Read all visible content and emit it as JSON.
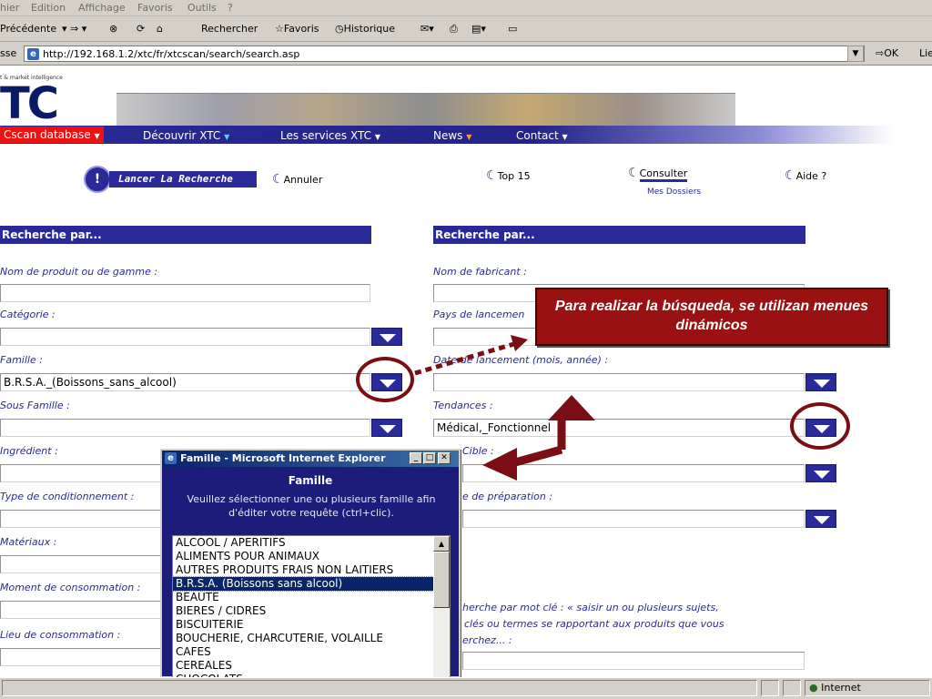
{
  "menubar": {
    "items": [
      "hier",
      "Edition",
      "Affichage",
      "Favoris",
      "Outils",
      "?"
    ]
  },
  "toolbar": {
    "back": "Précédente",
    "search": "Rechercher",
    "favorites": "Favoris",
    "history": "Historique"
  },
  "address": {
    "label": "sse",
    "url": "http://192.168.1.2/xtc/fr/xtcscan/search/search.asp",
    "go": "OK",
    "links": "Lie"
  },
  "site": {
    "tagline": "t & market intelligence",
    "logo": "TC",
    "nav": [
      "Cscan database",
      "Découvrir XTC",
      "Les services XTC",
      "News",
      "Contact"
    ],
    "actions": {
      "search": "Lancer La Recherche",
      "cancel": "Annuler",
      "top": "Top 15",
      "consult": "Consulter",
      "dossiers": "Mes Dossiers",
      "help": "Aide ?"
    }
  },
  "left": {
    "header": "Recherche par...",
    "fields": [
      {
        "label": "Nom de produit ou de gamme :",
        "value": ""
      },
      {
        "label": "Catégorie :",
        "value": ""
      },
      {
        "label": "Famille :",
        "value": "B.R.S.A._(Boissons_sans_alcool)"
      },
      {
        "label": "Sous Famille :",
        "value": ""
      },
      {
        "label": "Ingrédient :",
        "value": ""
      },
      {
        "label": "Type de conditionnement :",
        "value": ""
      },
      {
        "label": "Matériaux :",
        "value": ""
      },
      {
        "label": "Moment de consommation :",
        "value": ""
      },
      {
        "label": "Lieu de consommation :",
        "value": ""
      }
    ]
  },
  "right": {
    "header": "Recherche par...",
    "fields": [
      {
        "label": "Nom de fabricant :",
        "value": ""
      },
      {
        "label": "Pays de lancemen",
        "value": ""
      },
      {
        "label": "Date de lancement (mois, année) :",
        "value": ""
      },
      {
        "label": "Tendances :",
        "value": "Médical,_Fonctionnel"
      },
      {
        "label": "Cible :",
        "value": ""
      },
      {
        "label": "e de préparation :",
        "value": ""
      }
    ],
    "keyword": {
      "line1": "herche par mot clé : « saisir un ou plusieurs sujets,",
      "line2": "clés ou termes se rapportant aux produits que vous",
      "line3": "erchez... :"
    }
  },
  "callout": {
    "text": "Para realizar la búsqueda, se utilizan menues dinámicos"
  },
  "popup": {
    "title": "Famille - Microsoft Internet Explorer",
    "heading": "Famille",
    "instruction": "Veuillez sélectionner une ou plusieurs famille afin d'éditer votre requête (ctrl+clic).",
    "options": [
      "ALCOOL / APERITIFS",
      "ALIMENTS POUR ANIMAUX",
      "AUTRES PRODUITS FRAIS NON LAITIERS",
      "B.R.S.A. (Boissons sans alcool)",
      "BEAUTE",
      "BIERES / CIDRES",
      "BISCUITERIE",
      "BOUCHERIE, CHARCUTERIE, VOLAILLE",
      "CAFES",
      "CEREALES",
      "CHOCOLATS"
    ],
    "selected_index": 3
  },
  "status": {
    "zone": "Internet"
  },
  "colors": {
    "navy": "#2a2a9a",
    "highlight": "#7a0e14",
    "callout": "#991111"
  }
}
